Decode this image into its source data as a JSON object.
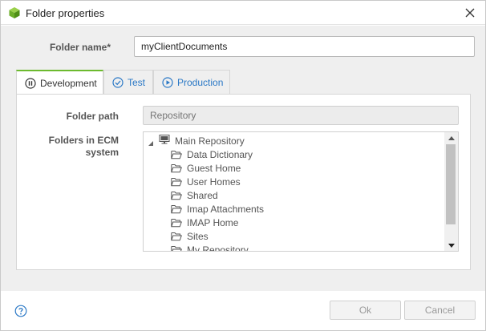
{
  "window": {
    "title": "Folder properties",
    "app_icon": "green-cube-icon",
    "close_icon": "close-icon"
  },
  "form": {
    "folder_name_label": "Folder name*",
    "folder_name_value": "myClientDocuments"
  },
  "tabs": [
    {
      "label": "Development",
      "icon": "pause-circle-icon",
      "active": true
    },
    {
      "label": "Test",
      "icon": "check-circle-icon",
      "active": false
    },
    {
      "label": "Production",
      "icon": "play-circle-icon",
      "active": false
    }
  ],
  "panel": {
    "folder_path_label": "Folder path",
    "folder_path_placeholder": "Repository",
    "ecm_label_line1": "Folders in ECM",
    "ecm_label_line2": "system",
    "tree": {
      "root": {
        "label": "Main Repository",
        "icon": "monitor-icon",
        "expanded": true
      },
      "children": [
        "Data Dictionary",
        "Guest Home",
        "User Homes",
        "Shared",
        "Imap Attachments",
        "IMAP Home",
        "Sites",
        "My Repository"
      ]
    }
  },
  "footer": {
    "help_icon": "help-circle-icon",
    "ok_label": "Ok",
    "cancel_label": "Cancel"
  },
  "colors": {
    "accent_green": "#6cba2f",
    "link_blue": "#2a78c6",
    "body_bg": "#efefef"
  }
}
